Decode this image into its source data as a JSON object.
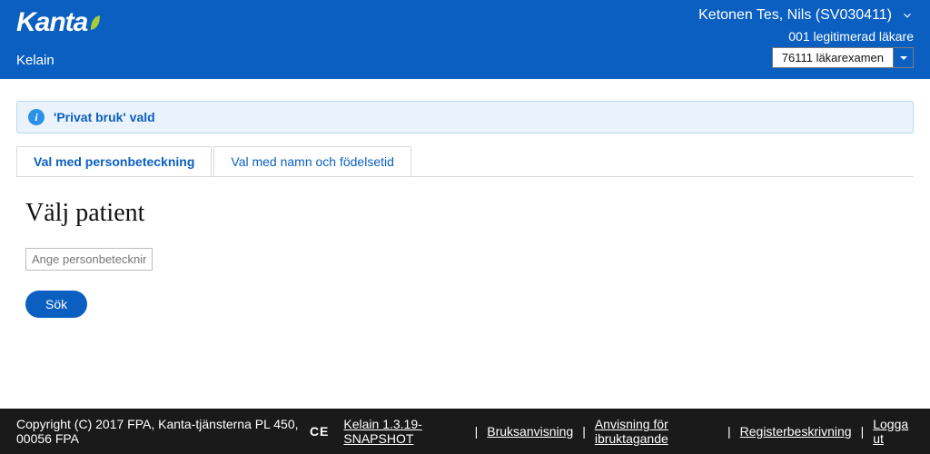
{
  "header": {
    "logo_text": "Kanta",
    "app_name": "Kelain",
    "user_display": "Ketonen Tes, Nils (SV030411)",
    "role_label": "001 legitimerad läkare",
    "role_select_value": "76111 läkarexamen"
  },
  "info_banner": {
    "text": "'Privat bruk' vald"
  },
  "tabs": [
    {
      "label": "Val med personbeteckning",
      "active": true
    },
    {
      "label": "Val med namn och födelsetid",
      "active": false
    }
  ],
  "panel": {
    "heading": "Välj patient",
    "pid_placeholder": "Ange personbeteckning",
    "search_label": "Sök"
  },
  "footer": {
    "copyright": "Copyright (C) 2017 FPA, Kanta-tjänsterna PL 450, 00056 FPA",
    "ce": "CE",
    "links": [
      "Kelain 1.3.19-SNAPSHOT",
      "Bruksanvisning",
      "Anvisning för ibruktagande",
      "Registerbeskrivning",
      "Logga ut"
    ]
  }
}
